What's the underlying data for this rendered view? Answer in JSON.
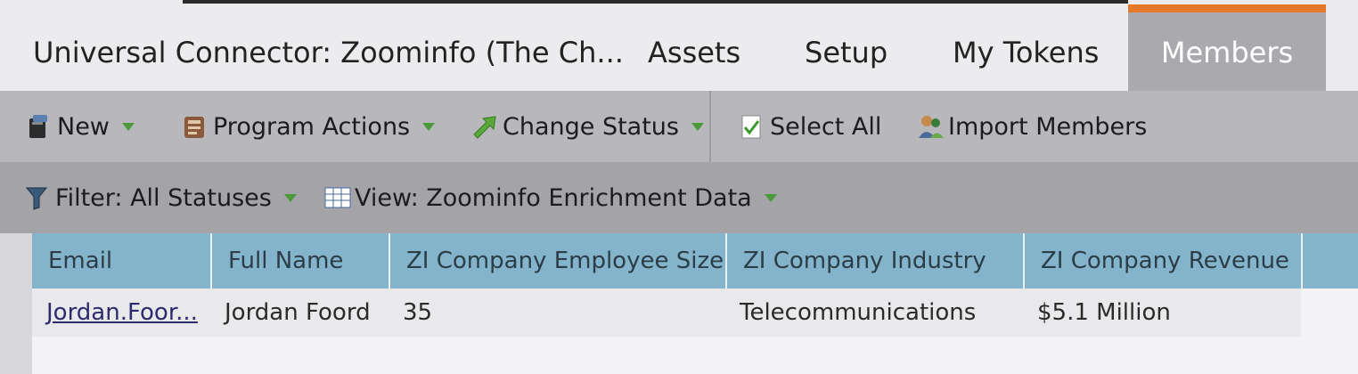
{
  "tabs": {
    "program_title": "Universal Connector: Zoominfo (The Ch...",
    "assets": "Assets",
    "setup": "Setup",
    "my_tokens": "My Tokens",
    "members": "Members",
    "active_accent": "#e4782b"
  },
  "toolbar": {
    "new_label": "New",
    "program_actions_label": "Program Actions",
    "change_status_label": "Change Status",
    "select_all_label": "Select All",
    "import_members_label": "Import Members"
  },
  "filterbar": {
    "filter_label": "Filter: All Statuses",
    "view_label": "View: Zoominfo Enrichment Data"
  },
  "table": {
    "columns": [
      "Email",
      "Full Name",
      "ZI Company Employee Size",
      "ZI Company Industry",
      "ZI Company Revenue"
    ],
    "rows": [
      [
        "Jordan.Foor...",
        "Jordan Foord",
        "35",
        "Telecommunications",
        "$5.1 Million"
      ]
    ]
  }
}
